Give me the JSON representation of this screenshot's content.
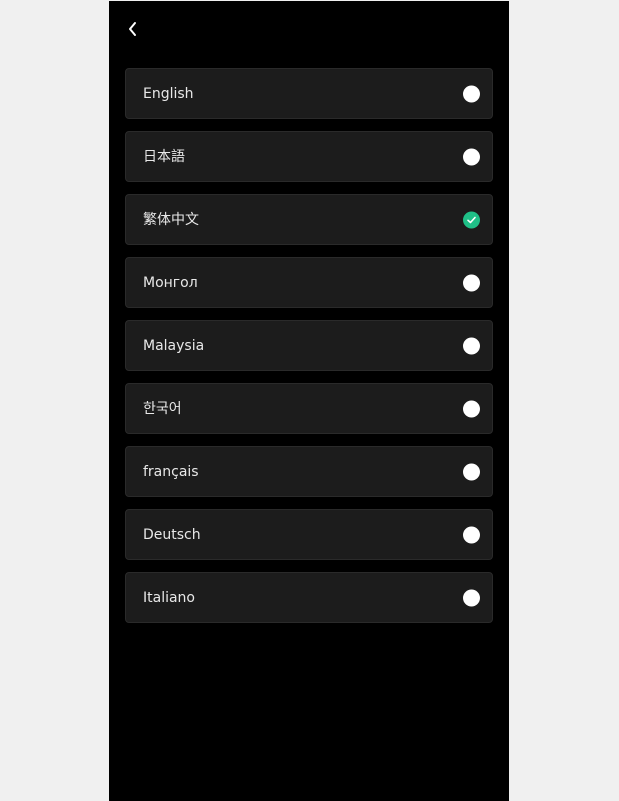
{
  "header": {
    "back_icon": "chevron-left-icon"
  },
  "languages": [
    {
      "label": "English",
      "selected": false
    },
    {
      "label": "日本語",
      "selected": false
    },
    {
      "label": "繁体中文",
      "selected": true
    },
    {
      "label": "Монгол",
      "selected": false
    },
    {
      "label": "Malaysia",
      "selected": false
    },
    {
      "label": "한국어",
      "selected": false
    },
    {
      "label": "français",
      "selected": false
    },
    {
      "label": "Deutsch",
      "selected": false
    },
    {
      "label": "Italiano",
      "selected": false
    }
  ],
  "colors": {
    "background": "#000000",
    "row_background": "#1c1c1c",
    "text": "#e8e8e8",
    "radio_unselected": "#ffffff",
    "radio_selected": "#1fbf87"
  },
  "icons": {
    "radio_unselected": "radio-unchecked-icon",
    "radio_selected": "radio-checked-icon"
  }
}
